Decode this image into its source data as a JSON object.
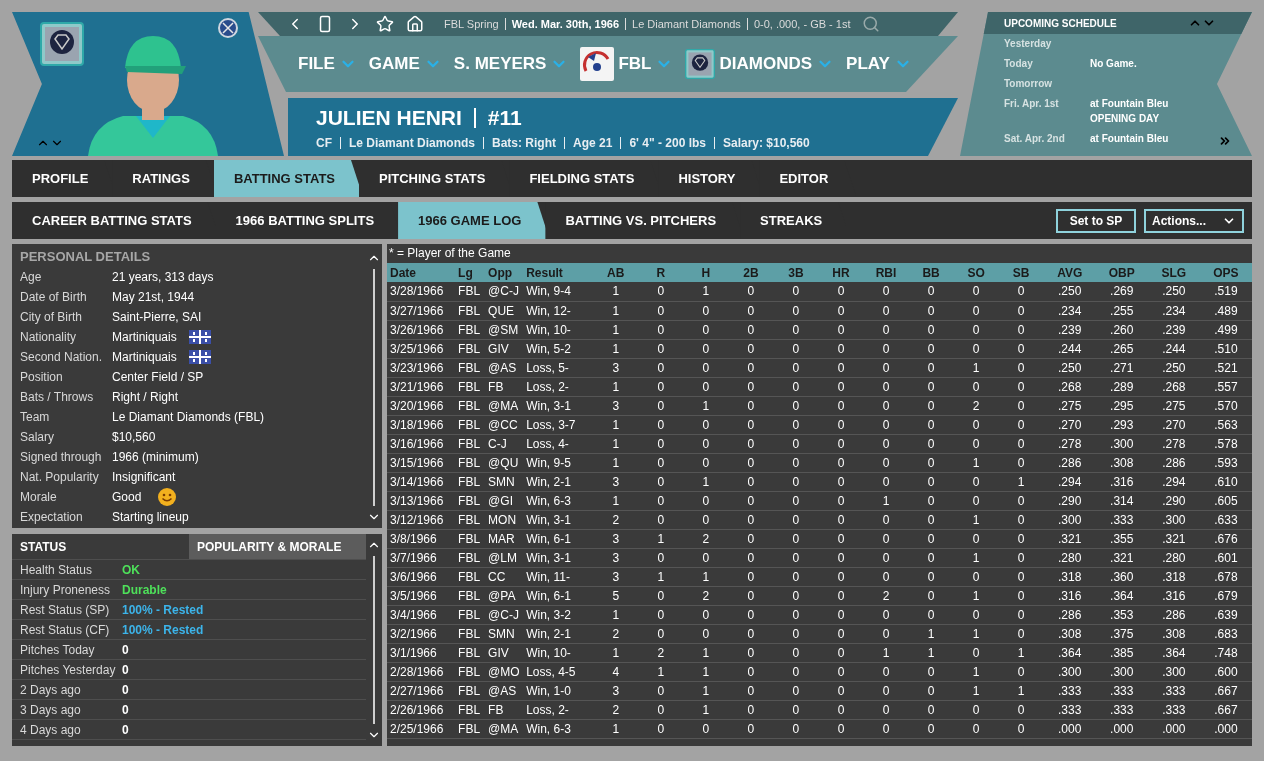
{
  "top_bar": {
    "items": [
      {
        "text": "FBL Spring",
        "bold": false
      },
      {
        "text": "Wed. Mar. 30th, 1966",
        "bold": true
      },
      {
        "text": "Le Diamant Diamonds",
        "bold": false
      },
      {
        "text": "0-0, .000, - GB - 1st",
        "bold": false
      }
    ]
  },
  "menus": [
    {
      "label": "FILE",
      "kind": "menu"
    },
    {
      "label": "GAME",
      "kind": "menu"
    },
    {
      "label": "S. MEYERS",
      "kind": "menu"
    },
    {
      "label": "FBL",
      "kind": "league"
    },
    {
      "label": "DIAMONDS",
      "kind": "team"
    },
    {
      "label": "PLAY",
      "kind": "menu"
    }
  ],
  "player": {
    "name": "JULIEN HENRI",
    "number": "#11",
    "info": [
      "CF",
      "Le Diamant Diamonds",
      "Bats: Right",
      "Age 21",
      "6' 4\" - 200 lbs",
      "Salary: $10,560"
    ]
  },
  "schedule": {
    "title": "UPCOMING SCHEDULE",
    "entries": [
      {
        "day": "Yesterday"
      },
      {
        "day": "Today",
        "lines": [
          "No Game."
        ]
      },
      {
        "day": "Tomorrow"
      },
      {
        "day": "Fri. Apr. 1st",
        "lines": [
          "at Fountain Bleu",
          "OPENING DAY"
        ]
      },
      {
        "day": "Sat. Apr. 2nd",
        "lines": [
          "at Fountain Bleu"
        ]
      }
    ]
  },
  "tabs": [
    {
      "label": "PROFILE",
      "selected": false
    },
    {
      "label": "RATINGS",
      "selected": false
    },
    {
      "label": "BATTING STATS",
      "selected": true
    },
    {
      "label": "PITCHING STATS",
      "selected": false
    },
    {
      "label": "FIELDING STATS",
      "selected": false
    },
    {
      "label": "HISTORY",
      "selected": false
    },
    {
      "label": "EDITOR",
      "selected": false
    }
  ],
  "subtabs": [
    {
      "label": "CAREER BATTING STATS",
      "selected": false
    },
    {
      "label": "1966 BATTING SPLITS",
      "selected": false
    },
    {
      "label": "1966 GAME LOG",
      "selected": true
    },
    {
      "label": "BATTING VS. PITCHERS",
      "selected": false
    },
    {
      "label": "STREAKS",
      "selected": false
    }
  ],
  "buttons": [
    {
      "label": "Set to SP",
      "kind": "plain"
    },
    {
      "label": "Actions...",
      "kind": "dropdown"
    }
  ],
  "personal_details": {
    "title": "PERSONAL DETAILS",
    "rows": [
      {
        "label": "Age",
        "value": "21 years, 313 days",
        "kind": "text"
      },
      {
        "label": "Date of Birth",
        "value": "May 21st, 1944",
        "kind": "text"
      },
      {
        "label": "City of Birth",
        "value": "Saint-Pierre, SAI",
        "kind": "text"
      },
      {
        "label": "Nationality",
        "value": "Martiniquais",
        "kind": "flag"
      },
      {
        "label": "Second Nation.",
        "value": "Martiniquais",
        "kind": "flag"
      },
      {
        "label": "Position",
        "value": "Center Field / SP",
        "kind": "text"
      },
      {
        "label": "Bats / Throws",
        "value": "Right / Right",
        "kind": "text"
      },
      {
        "label": "Team",
        "value": "Le Diamant Diamonds (FBL)",
        "kind": "text"
      },
      {
        "label": "Salary",
        "value": "$10,560",
        "kind": "text"
      },
      {
        "label": "Signed through",
        "value": "1966 (minimum)",
        "kind": "text"
      },
      {
        "label": "Nat. Popularity",
        "value": "Insignificant",
        "kind": "text"
      },
      {
        "label": "Morale",
        "value": "Good",
        "kind": "mood"
      },
      {
        "label": "Expectation",
        "value": "Starting lineup",
        "kind": "text"
      }
    ]
  },
  "status": {
    "tabs": [
      {
        "label": "STATUS",
        "selected": true
      },
      {
        "label": "POPULARITY & MORALE",
        "selected": false
      }
    ],
    "rows": [
      {
        "label": "Health Status",
        "value": "OK",
        "color": "#4ee05a"
      },
      {
        "label": "Injury Proneness",
        "value": "Durable",
        "color": "#4ee05a"
      },
      {
        "label": "Rest Status (SP)",
        "value": "100% - Rested",
        "color": "#3cb4ea"
      },
      {
        "label": "Rest Status (CF)",
        "value": "100% - Rested",
        "color": "#3cb4ea"
      },
      {
        "label": "Pitches Today",
        "value": "0",
        "color": "#ffffff"
      },
      {
        "label": "Pitches Yesterday",
        "value": "0",
        "color": "#ffffff"
      },
      {
        "label": "2 Days ago",
        "value": "0",
        "color": "#ffffff"
      },
      {
        "label": "3 Days ago",
        "value": "0",
        "color": "#ffffff"
      },
      {
        "label": "4 Days ago",
        "value": "0",
        "color": "#ffffff"
      }
    ]
  },
  "game_log": {
    "note": "* = Player of the Game",
    "columns": [
      "Date",
      "Lg",
      "Opp",
      "Result",
      "AB",
      "R",
      "H",
      "2B",
      "3B",
      "HR",
      "RBI",
      "BB",
      "SO",
      "SB",
      "AVG",
      "OBP",
      "SLG",
      "OPS"
    ],
    "rows": [
      [
        "3/28/1966",
        "FBL",
        "@C-J",
        "Win, 9-4",
        "1",
        "0",
        "1",
        "0",
        "0",
        "0",
        "0",
        "0",
        "0",
        "0",
        ".250",
        ".269",
        ".250",
        ".519"
      ],
      [
        "3/27/1966",
        "FBL",
        "QUE",
        "Win, 12-",
        "1",
        "0",
        "0",
        "0",
        "0",
        "0",
        "0",
        "0",
        "0",
        "0",
        ".234",
        ".255",
        ".234",
        ".489"
      ],
      [
        "3/26/1966",
        "FBL",
        "@SM",
        "Win, 10-",
        "1",
        "0",
        "0",
        "0",
        "0",
        "0",
        "0",
        "0",
        "0",
        "0",
        ".239",
        ".260",
        ".239",
        ".499"
      ],
      [
        "3/25/1966",
        "FBL",
        "GIV",
        "Win, 5-2",
        "1",
        "0",
        "0",
        "0",
        "0",
        "0",
        "0",
        "0",
        "0",
        "0",
        ".244",
        ".265",
        ".244",
        ".510"
      ],
      [
        "3/23/1966",
        "FBL",
        "@AS",
        "Loss, 5-",
        "3",
        "0",
        "0",
        "0",
        "0",
        "0",
        "0",
        "0",
        "1",
        "0",
        ".250",
        ".271",
        ".250",
        ".521"
      ],
      [
        "3/21/1966",
        "FBL",
        "FB",
        "Loss, 2-",
        "1",
        "0",
        "0",
        "0",
        "0",
        "0",
        "0",
        "0",
        "0",
        "0",
        ".268",
        ".289",
        ".268",
        ".557"
      ],
      [
        "3/20/1966",
        "FBL",
        "@MA",
        "Win, 3-1",
        "3",
        "0",
        "1",
        "0",
        "0",
        "0",
        "0",
        "0",
        "2",
        "0",
        ".275",
        ".295",
        ".275",
        ".570"
      ],
      [
        "3/18/1966",
        "FBL",
        "@CC",
        "Loss, 3-7",
        "1",
        "0",
        "0",
        "0",
        "0",
        "0",
        "0",
        "0",
        "0",
        "0",
        ".270",
        ".293",
        ".270",
        ".563"
      ],
      [
        "3/16/1966",
        "FBL",
        "C-J",
        "Loss, 4-",
        "1",
        "0",
        "0",
        "0",
        "0",
        "0",
        "0",
        "0",
        "0",
        "0",
        ".278",
        ".300",
        ".278",
        ".578"
      ],
      [
        "3/15/1966",
        "FBL",
        "@QU",
        "Win, 9-5",
        "1",
        "0",
        "0",
        "0",
        "0",
        "0",
        "0",
        "0",
        "1",
        "0",
        ".286",
        ".308",
        ".286",
        ".593"
      ],
      [
        "3/14/1966",
        "FBL",
        "SMN",
        "Win, 2-1",
        "3",
        "0",
        "1",
        "0",
        "0",
        "0",
        "0",
        "0",
        "0",
        "1",
        ".294",
        ".316",
        ".294",
        ".610"
      ],
      [
        "3/13/1966",
        "FBL",
        "@GI",
        "Win, 6-3",
        "1",
        "0",
        "0",
        "0",
        "0",
        "0",
        "1",
        "0",
        "0",
        "0",
        ".290",
        ".314",
        ".290",
        ".605"
      ],
      [
        "3/12/1966",
        "FBL",
        "MON",
        "Win, 3-1",
        "2",
        "0",
        "0",
        "0",
        "0",
        "0",
        "0",
        "0",
        "1",
        "0",
        ".300",
        ".333",
        ".300",
        ".633"
      ],
      [
        "3/8/1966",
        "FBL",
        "MAR",
        "Win, 6-1",
        "3",
        "1",
        "2",
        "0",
        "0",
        "0",
        "0",
        "0",
        "0",
        "0",
        ".321",
        ".355",
        ".321",
        ".676"
      ],
      [
        "3/7/1966",
        "FBL",
        "@LM",
        "Win, 3-1",
        "3",
        "0",
        "0",
        "0",
        "0",
        "0",
        "0",
        "0",
        "1",
        "0",
        ".280",
        ".321",
        ".280",
        ".601"
      ],
      [
        "3/6/1966",
        "FBL",
        "CC",
        "Win, 11-",
        "3",
        "1",
        "1",
        "0",
        "0",
        "0",
        "0",
        "0",
        "0",
        "0",
        ".318",
        ".360",
        ".318",
        ".678"
      ],
      [
        "3/5/1966",
        "FBL",
        "@PA",
        "Win, 6-1",
        "5",
        "0",
        "2",
        "0",
        "0",
        "0",
        "2",
        "0",
        "1",
        "0",
        ".316",
        ".364",
        ".316",
        ".679"
      ],
      [
        "3/4/1966",
        "FBL",
        "@C-J",
        "Win, 3-2",
        "1",
        "0",
        "0",
        "0",
        "0",
        "0",
        "0",
        "0",
        "0",
        "0",
        ".286",
        ".353",
        ".286",
        ".639"
      ],
      [
        "3/2/1966",
        "FBL",
        "SMN",
        "Win, 2-1",
        "2",
        "0",
        "0",
        "0",
        "0",
        "0",
        "0",
        "1",
        "1",
        "0",
        ".308",
        ".375",
        ".308",
        ".683"
      ],
      [
        "3/1/1966",
        "FBL",
        "GIV",
        "Win, 10-",
        "1",
        "2",
        "1",
        "0",
        "0",
        "0",
        "1",
        "1",
        "0",
        "1",
        ".364",
        ".385",
        ".364",
        ".748"
      ],
      [
        "2/28/1966",
        "FBL",
        "@MO",
        "Loss, 4-5",
        "4",
        "1",
        "1",
        "0",
        "0",
        "0",
        "0",
        "0",
        "1",
        "0",
        ".300",
        ".300",
        ".300",
        ".600"
      ],
      [
        "2/27/1966",
        "FBL",
        "@AS",
        "Win, 1-0",
        "3",
        "0",
        "1",
        "0",
        "0",
        "0",
        "0",
        "0",
        "1",
        "1",
        ".333",
        ".333",
        ".333",
        ".667"
      ],
      [
        "2/26/1966",
        "FBL",
        "FB",
        "Loss, 2-",
        "2",
        "0",
        "1",
        "0",
        "0",
        "0",
        "0",
        "0",
        "0",
        "0",
        ".333",
        ".333",
        ".333",
        ".667"
      ],
      [
        "2/25/1966",
        "FBL",
        "@MA",
        "Win, 6-3",
        "1",
        "0",
        "0",
        "0",
        "0",
        "0",
        "0",
        "0",
        "0",
        "0",
        ".000",
        ".000",
        ".000",
        ".000"
      ]
    ]
  }
}
